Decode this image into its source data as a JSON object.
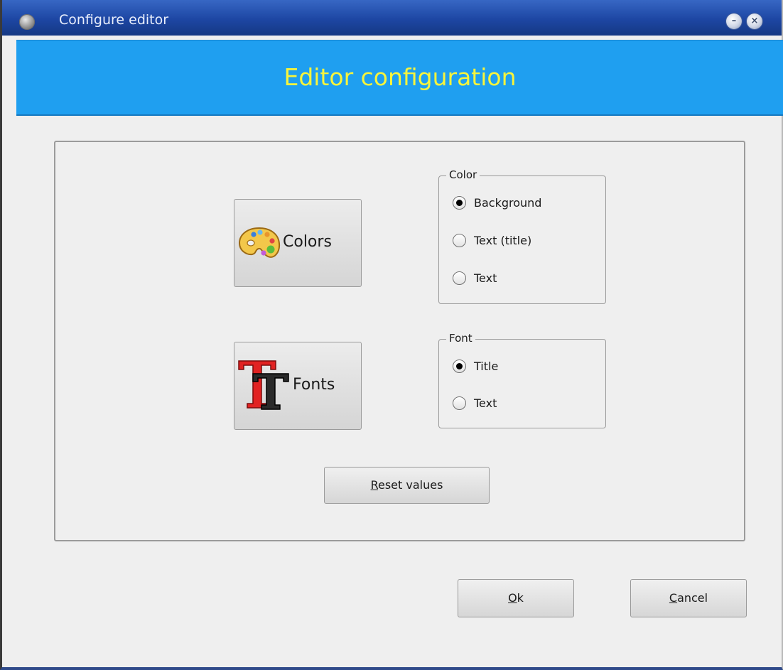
{
  "window": {
    "title": "Configure editor",
    "icons": {
      "app": "app-icon",
      "minimize": "minimize-icon",
      "close": "close-icon"
    }
  },
  "banner": {
    "title": "Editor configuration",
    "background": "#1f9ff0",
    "text_color": "#f7f43c"
  },
  "buttons": {
    "colors": {
      "label": "Colors",
      "icon": "palette-icon"
    },
    "fonts": {
      "label": "Fonts",
      "icon": "font-tt-icon"
    },
    "reset": {
      "mnemonic": "R",
      "rest": "eset values"
    },
    "ok": {
      "mnemonic": "O",
      "rest": "k"
    },
    "cancel": {
      "mnemonic": "C",
      "rest": "ancel"
    }
  },
  "color_group": {
    "legend": "Color",
    "options": [
      {
        "label": "Background",
        "checked": true
      },
      {
        "label": "Text (title)",
        "checked": false
      },
      {
        "label": "Text",
        "checked": false
      }
    ]
  },
  "font_group": {
    "legend": "Font",
    "options": [
      {
        "label": "Title",
        "checked": true
      },
      {
        "label": "Text",
        "checked": false
      }
    ]
  }
}
